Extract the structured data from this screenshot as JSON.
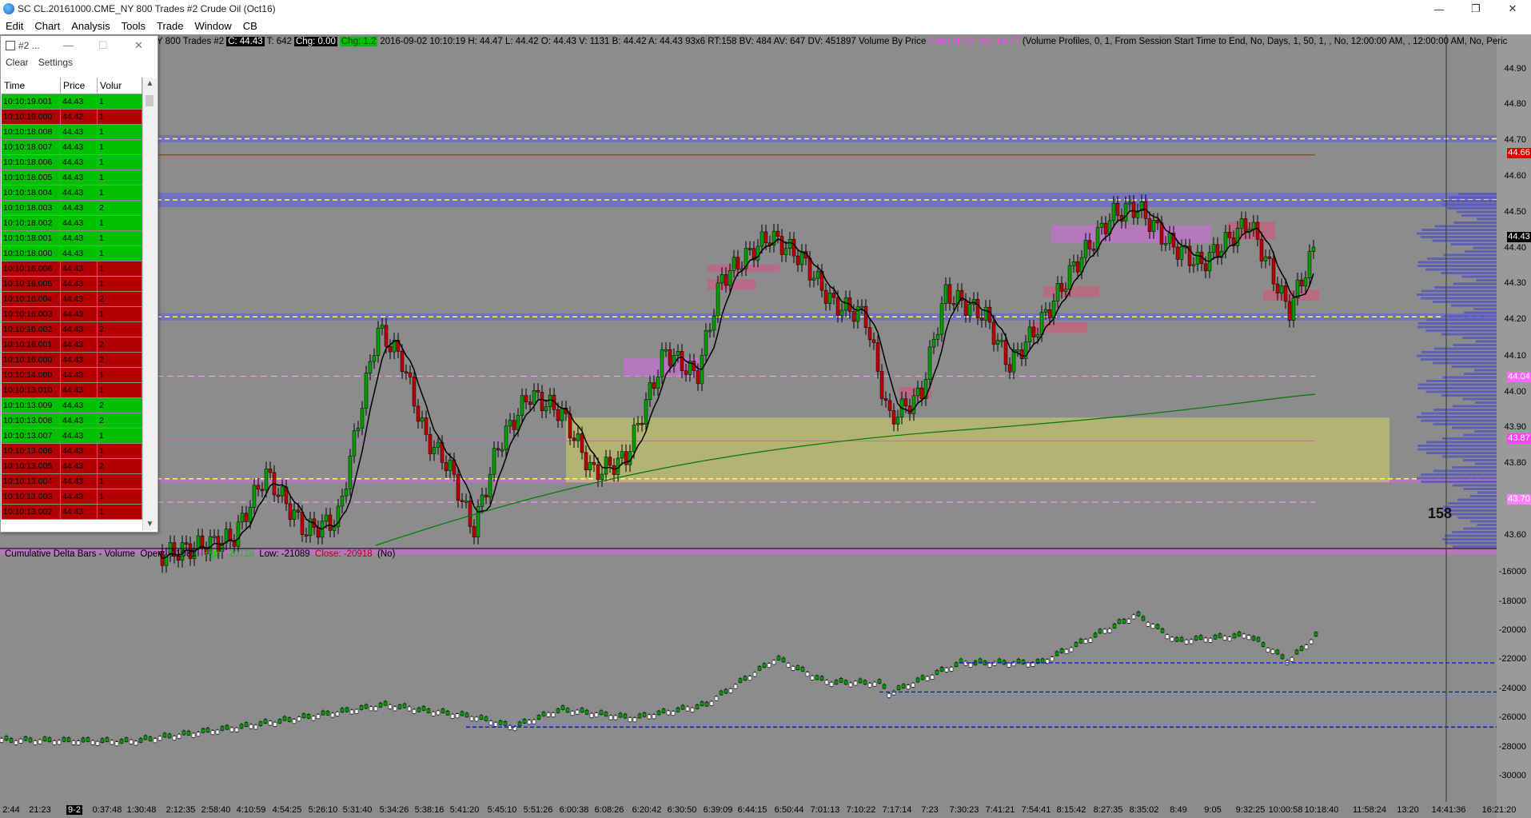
{
  "window": {
    "title": "SC CL.20161000.CME_NY  800 Trades  #2  Crude Oil (Oct16)",
    "minimize": "—",
    "restore": "❐",
    "close": "✕"
  },
  "menu": [
    "Edit",
    "Chart",
    "Analysis",
    "Tools",
    "Trade",
    "Window",
    "CB"
  ],
  "infobar": {
    "prefix": "Y  800 Trades  #2",
    "close": "C: 44.43",
    "trades": "T: 642",
    "chg": "Chg: 0.00",
    "chg2": "Chg: 1.2",
    "stats": "2016-09-02 10:10:19 H: 44.47  L: 44.42  O: 44.43  V: 1131  B: 44.42  A: 44.43  93x6  RT:158  BV: 484  AV: 647  DV: 451897  Volume By Price",
    "poc": "Point of Control: 44.47",
    "profile": "(Volume Profiles, 0, 1, From Session Start Time to End, No, Days, 1, 50, 1, , No, 12:00:00 AM, , 12:00:00 AM, No, Peric"
  },
  "delta_study": {
    "name": "Cumulative Delta Bars - Volume",
    "open": "Open: -21081",
    "high": "High: -20728",
    "low": "Low: -21089",
    "close": "Close: -20918",
    "flag": "(No)"
  },
  "price_axis": {
    "labels": [
      "44.90",
      "44.80",
      "44.70",
      "44.60",
      "44.50",
      "44.40",
      "44.30",
      "44.20",
      "44.10",
      "44.00",
      "43.90",
      "43.80",
      "43.60"
    ],
    "tags": [
      {
        "text": "44.66",
        "bg": "#e00000",
        "fg": "#ffffff"
      },
      {
        "text": "44.43",
        "bg": "#000000",
        "fg": "#ffffff"
      },
      {
        "text": "44.04",
        "bg": "#ff66ff",
        "fg": "#ffffff"
      },
      {
        "text": "43.87",
        "bg": "#ff40ff",
        "fg": "#ffffff"
      },
      {
        "text": "43.70",
        "bg": "#ff80ff",
        "fg": "#ffffff"
      }
    ]
  },
  "delta_axis": [
    "-16000",
    "-18000",
    "-20000",
    "-22000",
    "-24000",
    "-26000",
    "-28000",
    "-30000"
  ],
  "counter": "158",
  "time_axis": [
    "2:44",
    "21:23",
    "9-2",
    "0:37:48",
    "1:30:48",
    "2:12:35",
    "2:58:40",
    "4:10:59",
    "4:54:25",
    "5:26:10",
    "5:31:40",
    "5:34:26",
    "5:38:16",
    "5:41:20",
    "5:45:10",
    "5:51:26",
    "6:00:38",
    "6:08:26",
    "6:20:42",
    "6:30:50",
    "6:39:09",
    "6:44:15",
    "6:50:44",
    "7:01:13",
    "7:10:22",
    "7:17:14",
    "7:23",
    "7:30:23",
    "7:41:21",
    "7:54:41",
    "8:15:42",
    "8:27:35",
    "8:35:02",
    "8:49",
    "9:05",
    "9:32:25",
    "10:00:58",
    "10:18:40",
    "11:58:24",
    "13:20",
    "14:41:36",
    "16:21:20"
  ],
  "time_and_sales": {
    "title": "#2 ...",
    "clear": "Clear",
    "settings": "Settings",
    "columns": [
      "Time",
      "Price",
      "Volur"
    ],
    "rows": [
      {
        "time": "10:10:19.001",
        "price": "44.43",
        "vol": "1",
        "side": "buy"
      },
      {
        "time": "10:10:19.000",
        "price": "44.42",
        "vol": "1",
        "side": "sell"
      },
      {
        "time": "10:10:18.008",
        "price": "44.43",
        "vol": "1",
        "side": "buy"
      },
      {
        "time": "10:10:18.007",
        "price": "44.43",
        "vol": "1",
        "side": "buy"
      },
      {
        "time": "10:10:18.006",
        "price": "44.43",
        "vol": "1",
        "side": "buy"
      },
      {
        "time": "10:10:18.005",
        "price": "44.43",
        "vol": "1",
        "side": "buy"
      },
      {
        "time": "10:10:18.004",
        "price": "44.43",
        "vol": "1",
        "side": "buy"
      },
      {
        "time": "10:10:18.003",
        "price": "44.43",
        "vol": "2",
        "side": "buy"
      },
      {
        "time": "10:10:18.002",
        "price": "44.43",
        "vol": "1",
        "side": "buy"
      },
      {
        "time": "10:10:18.001",
        "price": "44.43",
        "vol": "1",
        "side": "buy"
      },
      {
        "time": "10:10:18.000",
        "price": "44.43",
        "vol": "1",
        "side": "buy"
      },
      {
        "time": "10:10:16.006",
        "price": "44.43",
        "vol": "1",
        "side": "sell"
      },
      {
        "time": "10:10:16.005",
        "price": "44.43",
        "vol": "1",
        "side": "sell"
      },
      {
        "time": "10:10:16.004",
        "price": "44.43",
        "vol": "2",
        "side": "sell"
      },
      {
        "time": "10:10:16.003",
        "price": "44.43",
        "vol": "1",
        "side": "sell"
      },
      {
        "time": "10:10:16.002",
        "price": "44.43",
        "vol": "2",
        "side": "sell"
      },
      {
        "time": "10:10:16.001",
        "price": "44.43",
        "vol": "2",
        "side": "sell"
      },
      {
        "time": "10:10:16.000",
        "price": "44.43",
        "vol": "2",
        "side": "sell"
      },
      {
        "time": "10:10:14.000",
        "price": "44.43",
        "vol": "1",
        "side": "sell"
      },
      {
        "time": "10:10:13.010",
        "price": "44.43",
        "vol": "1",
        "side": "sell"
      },
      {
        "time": "10:10:13.009",
        "price": "44.43",
        "vol": "2",
        "side": "buy"
      },
      {
        "time": "10:10:13.008",
        "price": "44.43",
        "vol": "2",
        "side": "buy"
      },
      {
        "time": "10:10:13.007",
        "price": "44.43",
        "vol": "1",
        "side": "buy"
      },
      {
        "time": "10:10:13.006",
        "price": "44.43",
        "vol": "1",
        "side": "sell"
      },
      {
        "time": "10:10:13.005",
        "price": "44.43",
        "vol": "2",
        "side": "sell"
      },
      {
        "time": "10:10:13.004",
        "price": "44.43",
        "vol": "1",
        "side": "sell"
      },
      {
        "time": "10:10:13.003",
        "price": "44.43",
        "vol": "1",
        "side": "sell"
      },
      {
        "time": "10:10:13.002",
        "price": "44.43",
        "vol": "1",
        "side": "sell"
      }
    ]
  },
  "colors": {
    "background": "#8c8c8c",
    "zone_blue": "#6a6ad0",
    "zone_magenta": "#c46fd0",
    "value_area": "#c8c86a",
    "up_candle": "#00a000",
    "down_candle": "#c00000",
    "avg_line": "#000000",
    "long_avg": "#007a00"
  }
}
